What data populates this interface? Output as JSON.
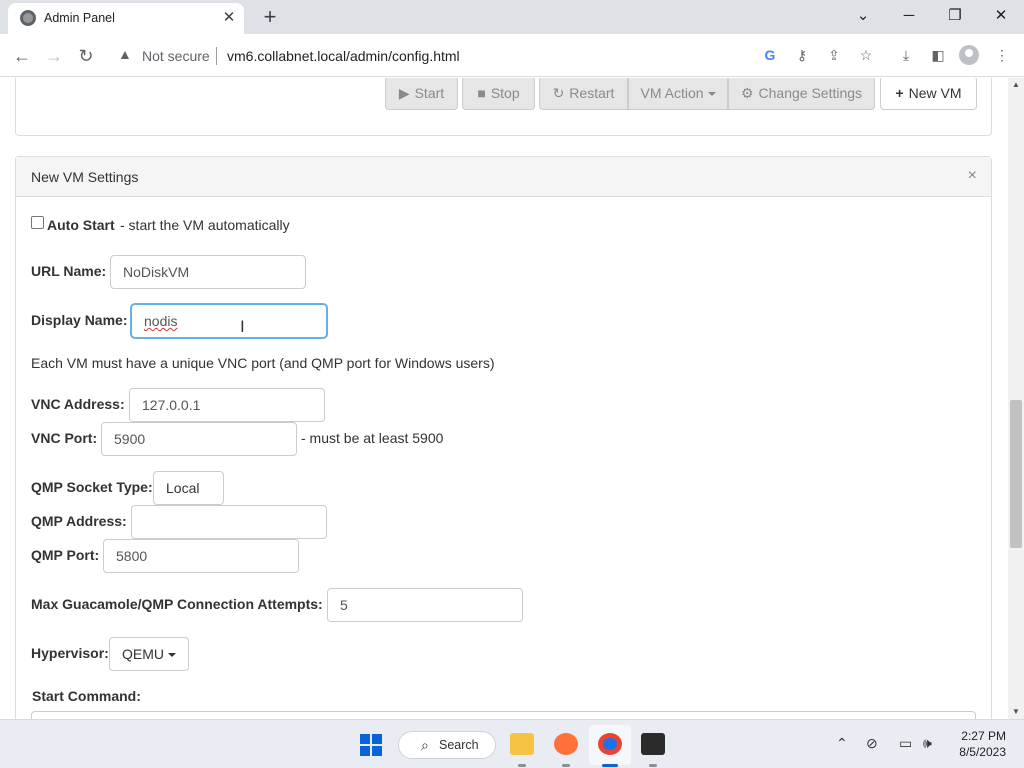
{
  "browser": {
    "tab_title": "Admin Panel",
    "tab_close": "✕",
    "new_tab": "+",
    "window_controls": {
      "chevron": "⌄",
      "minimize": "─",
      "restore": "❐",
      "close": "✕"
    },
    "security_label": "Not secure",
    "url": "vm6.collabnet.local/admin/config.html",
    "toolbar_icons": [
      "google-icon",
      "key-icon",
      "share-icon",
      "star-icon",
      "download-icon",
      "sidepanel-icon",
      "profile-icon",
      "menu-icon"
    ]
  },
  "actions": {
    "start": "Start",
    "stop": "Stop",
    "restart": "Restart",
    "vm_action": "VM Action",
    "change_settings": "Change Settings",
    "new_vm": "New VM"
  },
  "panel": {
    "title": "New VM Settings",
    "close": "×"
  },
  "form": {
    "auto_start_label": "Auto Start",
    "auto_start_desc": " - start the VM automatically",
    "auto_start_checked": false,
    "url_name_label": "URL Name:",
    "url_name_value": "NoDiskVM",
    "display_name_label": "Display Name:",
    "display_name_value": "nodis",
    "vnc_note": "Each VM must have a unique VNC port (and QMP port for Windows users)",
    "vnc_address_label": "VNC Address:",
    "vnc_address_value": "127.0.0.1",
    "vnc_port_label": "VNC Port:",
    "vnc_port_value": "5900",
    "vnc_port_note": "- must be at least 5900",
    "qmp_socket_type_label": "QMP Socket Type:",
    "qmp_socket_type_value": "Local",
    "qmp_address_label": "QMP Address:",
    "qmp_address_value": "",
    "qmp_port_label": "QMP Port:",
    "qmp_port_value": "5800",
    "max_attempts_label": "Max Guacamole/QMP Connection Attempts:",
    "max_attempts_value": "5",
    "hypervisor_label": "Hypervisor:",
    "hypervisor_value": "QEMU",
    "start_command_label": "Start Command:"
  },
  "taskbar": {
    "search_label": "Search",
    "time": "2:27 PM",
    "date": "8/5/2023"
  },
  "colors": {
    "focus_border": "#66afe9",
    "panel_header_bg": "#f5f5f5",
    "disabled_button_bg": "#e6e6e6"
  }
}
